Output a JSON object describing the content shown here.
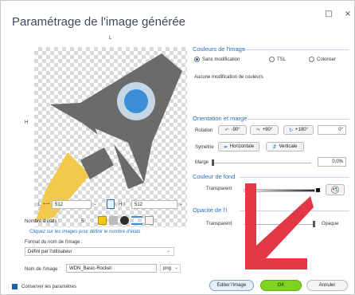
{
  "window": {
    "title": "Paramétrage de l'image générée",
    "maximize": "□",
    "close": "×"
  },
  "preview": {
    "top_marker": "L",
    "left_marker": "H"
  },
  "size": {
    "width_label": "L",
    "width": "512",
    "height_label": "H",
    "height": "512"
  },
  "states": {
    "label": "Nombre d'états :",
    "value": "5",
    "hint": "Cliquez sur les images pour définir le nombre d'états"
  },
  "format": {
    "label": "Format du nom de l'image :",
    "value": "Défini par l'utilisateur"
  },
  "name": {
    "label": "Nom de l'image :",
    "value": "WDN_Basic-Rocket",
    "ext": "png"
  },
  "keep": {
    "label": "Conserver les paramètres"
  },
  "color": {
    "title": "Couleurs de l'image",
    "opt1": "Sans modification",
    "opt2": "TSL",
    "opt3": "Coloriser",
    "status": "Aucune modification de couleurs"
  },
  "orient": {
    "title": "Orientation et marge",
    "rotation": "Rotation",
    "rot1": "-90°",
    "rot2": "+90°",
    "rot3": "+180°",
    "rot_val": "0°",
    "sym": "Symétrie",
    "horiz": "Horizontale",
    "vert": "Verticale",
    "marge": "Marge",
    "marge_val": "0.0%"
  },
  "bg": {
    "title": "Couleur de fond",
    "transparent": "Transparent"
  },
  "opacity": {
    "title": "Opacité de l'i",
    "transparent": "Transparent",
    "opaque": "Opaque"
  },
  "footer": {
    "edit": "Editer l'image",
    "ok": "OK",
    "cancel": "Annuler"
  },
  "colors": {
    "accent": "#2a6fb8",
    "ok": "#7ed321",
    "arrow": "#e23845",
    "rocket": "#6b6b6b",
    "window": "#3a8fd8",
    "flame": "#f2c94c"
  }
}
